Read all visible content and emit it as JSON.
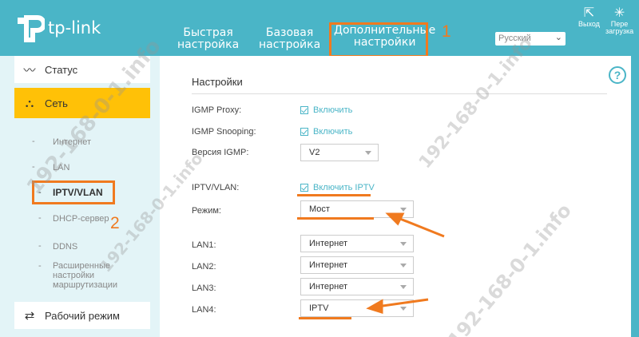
{
  "header": {
    "logo_text": "tp-link",
    "tabs": [
      {
        "line1": "Быстрая",
        "line2": "настройка"
      },
      {
        "line1": "Базовая",
        "line2": "настройка"
      },
      {
        "line1": "Дополнительные",
        "line2": "настройки"
      }
    ],
    "annotation_1": "1",
    "language": "Русский",
    "logout_label": "Выход",
    "reboot_label_1": "Пере",
    "reboot_label_2": "загрузка"
  },
  "sidebar": {
    "status": "Статус",
    "network": "Сеть",
    "sub_items": [
      "Интернет",
      "LAN",
      "IPTV/VLAN",
      "DHCP-сервер",
      "DDNS"
    ],
    "advanced_routing": [
      "Расширенные",
      "настройки",
      "маршрутизации"
    ],
    "work_mode": "Рабочий режим",
    "annotation_2": "2"
  },
  "content": {
    "section_title": "Настройки",
    "help": "?",
    "igmp_proxy_label": "IGMP Proxy:",
    "igmp_proxy_check": "Включить",
    "igmp_snooping_label": "IGMP Snooping:",
    "igmp_snooping_check": "Включить",
    "igmp_version_label": "Версия IGMP:",
    "igmp_version_value": "V2",
    "iptv_label": "IPTV/VLAN:",
    "iptv_check": "Включить IPTV",
    "mode_label": "Режим:",
    "mode_value": "Мост",
    "lan1_label": "LAN1:",
    "lan1_value": "Интернет",
    "lan2_label": "LAN2:",
    "lan2_value": "Интернет",
    "lan3_label": "LAN3:",
    "lan3_value": "Интернет",
    "lan4_label": "LAN4:",
    "lan4_value": "IPTV"
  },
  "watermark": "192-168-0-1.info",
  "colors": {
    "brand": "#4ab5c7",
    "active_menu": "#ffc107",
    "annotation": "#f07a1f"
  }
}
